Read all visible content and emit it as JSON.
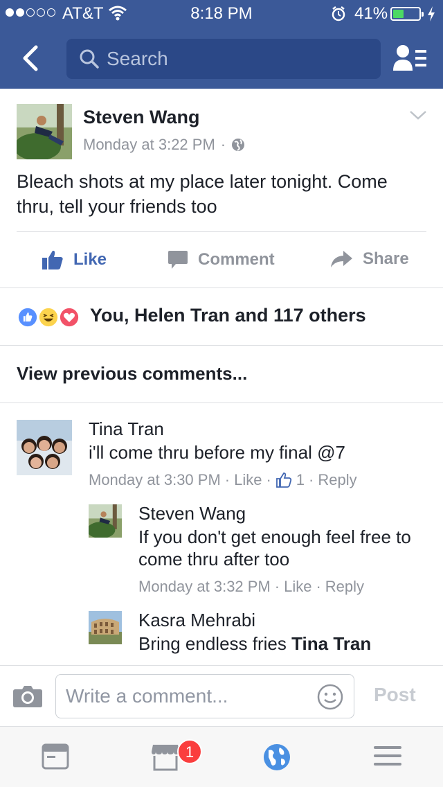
{
  "status_bar": {
    "carrier": "AT&T",
    "time": "8:18 PM",
    "battery": "41%",
    "battery_level": 0.41,
    "signal_bars": 2
  },
  "nav": {
    "search_placeholder": "Search"
  },
  "post": {
    "author": "Steven Wang",
    "timestamp": "Monday at 3:22 PM",
    "separator": "·",
    "text": "Bleach shots at my place later tonight. Come thru, tell your friends too",
    "actions": {
      "like": "Like",
      "comment": "Comment",
      "share": "Share"
    },
    "reactions_text": "You, Helen Tran and 117 others"
  },
  "comments": {
    "view_previous": "View previous comments...",
    "items": [
      {
        "author": "Tina Tran",
        "text": "i'll come thru before my final @7",
        "timestamp": "Monday at 3:30 PM",
        "like_label": "Like",
        "like_count": "1",
        "reply_label": "Reply"
      },
      {
        "author": "Steven Wang",
        "text": "If you don't get enough feel free to come thru after too",
        "timestamp": "Monday at 3:32 PM",
        "like_label": "Like",
        "reply_label": "Reply"
      },
      {
        "author": "Kasra Mehrabi",
        "text": "Bring endless fries",
        "mention": "Tina Tran"
      }
    ]
  },
  "composer": {
    "placeholder": "Write a comment...",
    "post_label": "Post"
  },
  "tabbar": {
    "marketplace_badge": "1"
  },
  "colors": {
    "brand": "#3b5998",
    "like_blue": "#4267b2",
    "meta_gray": "#90949c"
  }
}
